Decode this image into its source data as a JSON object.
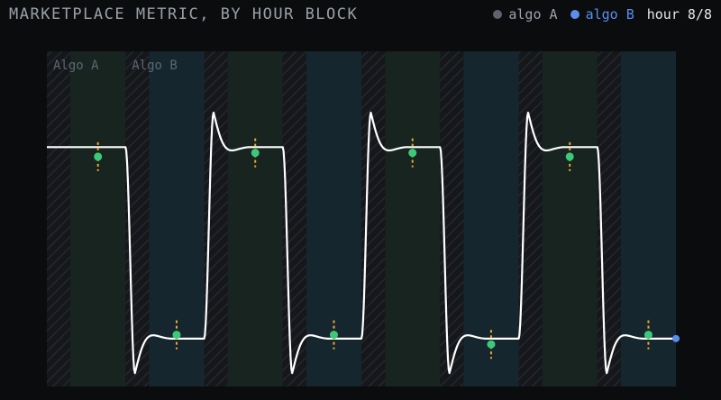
{
  "title": "MARKETPLACE METRIC, BY HOUR BLOCK",
  "legend": {
    "algo_a": {
      "label": "algo A",
      "color": "#5f636b"
    },
    "algo_b": {
      "label": "algo B",
      "color": "#5b8def"
    },
    "hour_label": "hour",
    "hour_current": 8,
    "hour_total": 8,
    "hour_readout": "8/8"
  },
  "regions": {
    "algo_a_label": "Algo A",
    "algo_b_label": "Algo B"
  },
  "colors": {
    "background": "#0b0c0e",
    "plot_background": "#14181c",
    "block_a": "#17241f",
    "block_b": "#16262e",
    "transition_stripe": "#1b1d23",
    "signal": "#ffffff",
    "marker": "#3cc97a",
    "marker_tick": "#f0a830",
    "end_marker": "#5b8def"
  },
  "chart_data": {
    "type": "line",
    "title": "MARKETPLACE METRIC, BY HOUR BLOCK",
    "xlabel": "",
    "ylabel": "",
    "grid": false,
    "legend_position": "top-right",
    "hours": 8,
    "block_pattern": [
      "algo A",
      "algo B",
      "algo A",
      "algo B",
      "algo A",
      "algo B",
      "algo A",
      "algo B"
    ],
    "levels": {
      "algo A": 1,
      "algo B": 0
    },
    "ylim": [
      -0.25,
      1.5
    ],
    "xlim": [
      0,
      8
    ],
    "step_response": {
      "overshoot": 0.18,
      "damping": 0.5,
      "settle_fraction": 0.45
    },
    "markers": [
      {
        "hour": 1,
        "x": 0.65,
        "value": 0.95
      },
      {
        "hour": 2,
        "x": 1.65,
        "value": 0.02
      },
      {
        "hour": 3,
        "x": 2.65,
        "value": 0.97
      },
      {
        "hour": 4,
        "x": 3.65,
        "value": 0.02
      },
      {
        "hour": 5,
        "x": 4.65,
        "value": 0.97
      },
      {
        "hour": 6,
        "x": 5.65,
        "value": -0.03
      },
      {
        "hour": 7,
        "x": 6.65,
        "value": 0.95
      },
      {
        "hour": 8,
        "x": 7.65,
        "value": 0.02
      }
    ],
    "end_point": {
      "x": 8,
      "value": 0
    }
  }
}
